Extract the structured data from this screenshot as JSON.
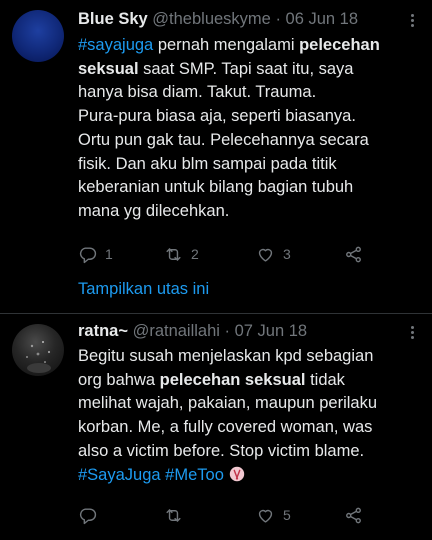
{
  "tweets": [
    {
      "name": "Blue Sky",
      "handle": "@theblueskyme",
      "dot": " · ",
      "date": "06 Jun 18",
      "lines": [
        [
          {
            "t": "#sayajuga",
            "c": "tag"
          },
          {
            "t": " pernah mengalami ",
            "c": ""
          },
          {
            "t": "pelecehan",
            "c": "bold"
          }
        ],
        [
          {
            "t": "seksual",
            "c": "bold"
          },
          {
            "t": " saat SMP. Tapi saat itu, saya",
            "c": ""
          }
        ],
        [
          {
            "t": "hanya bisa diam. Takut. Trauma.",
            "c": ""
          }
        ],
        [
          {
            "t": "Pura-pura biasa aja, seperti biasanya.",
            "c": ""
          }
        ],
        [
          {
            "t": "Ortu pun gak tau. Pelecehannya secara",
            "c": ""
          }
        ],
        [
          {
            "t": "fisik. Dan aku blm sampai pada titik",
            "c": ""
          }
        ],
        [
          {
            "t": "keberanian untuk bilang bagian tubuh",
            "c": ""
          }
        ],
        [
          {
            "t": "mana yg dilecehkan.",
            "c": ""
          }
        ]
      ],
      "replies": "1",
      "retweets": "2",
      "likes": "3",
      "thread_link": "Tampilkan utas ini"
    },
    {
      "name": "ratna~",
      "handle": "@ratnaillahi",
      "dot": " · ",
      "date": "07 Jun 18",
      "lines": [
        [
          {
            "t": "Begitu susah menjelaskan kpd sebagian",
            "c": ""
          }
        ],
        [
          {
            "t": "org bahwa ",
            "c": ""
          },
          {
            "t": "pelecehan seksual",
            "c": "bold"
          },
          {
            "t": " tidak",
            "c": ""
          }
        ],
        [
          {
            "t": "melihat wajah, pakaian, maupun perilaku",
            "c": ""
          }
        ],
        [
          {
            "t": "korban. Me, a fully covered woman, was",
            "c": ""
          }
        ],
        [
          {
            "t": "also a victim before. Stop victim blame.",
            "c": ""
          }
        ],
        [
          {
            "t": "#SayaJuga",
            "c": "tag"
          },
          {
            "t": " ",
            "c": ""
          },
          {
            "t": "#MeToo",
            "c": "tag"
          },
          {
            "t": " ",
            "c": ""
          }
        ]
      ],
      "replies": "",
      "retweets": "",
      "likes": "5"
    }
  ],
  "colors": {
    "background": "#000000",
    "text": "#e7e9ea",
    "muted": "#71767b",
    "link": "#1d9bf0",
    "divider": "#2f3336"
  },
  "icons": [
    "more-icon",
    "reply-icon",
    "retweet-icon",
    "like-icon",
    "share-icon",
    "metoo-emoji-icon"
  ]
}
